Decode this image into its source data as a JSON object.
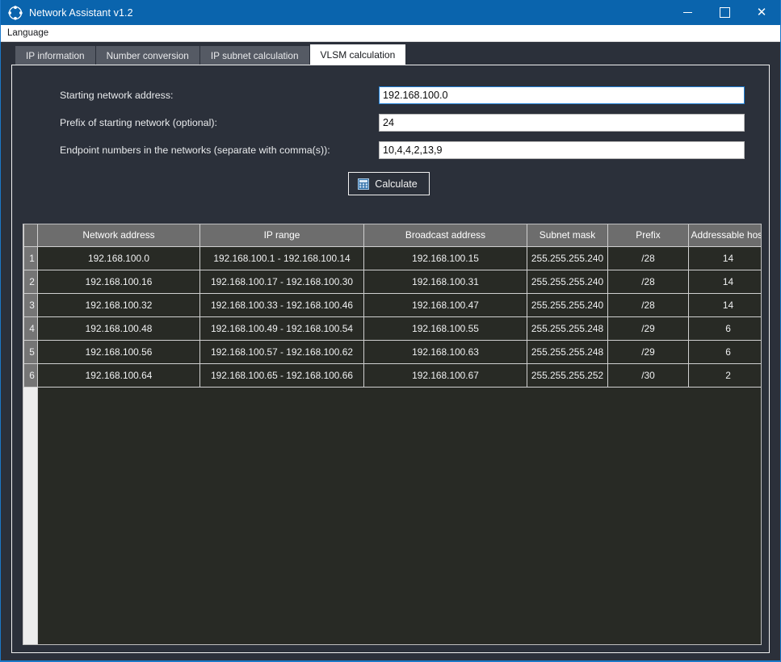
{
  "window": {
    "title": "Network Assistant v1.2",
    "icon": "network-hub-icon",
    "accent_color": "#0a64ad",
    "background_color": "#2b303a",
    "controls": {
      "minimize": "minimize-icon",
      "maximize": "maximize-icon",
      "close": "close-icon"
    }
  },
  "menubar": {
    "items": [
      {
        "label": "Language"
      }
    ]
  },
  "tabs": [
    {
      "label": "IP information",
      "active": false
    },
    {
      "label": "Number conversion",
      "active": false
    },
    {
      "label": "IP subnet calculation",
      "active": false
    },
    {
      "label": "VLSM calculation",
      "active": true
    }
  ],
  "form": {
    "fields": [
      {
        "label": "Starting network address:",
        "value": "192.168.100.0",
        "placeholder": "",
        "focused": true
      },
      {
        "label": "Prefix of starting network (optional):",
        "value": "24",
        "placeholder": "",
        "focused": false
      },
      {
        "label": "Endpoint numbers in the networks (separate with comma(s)):",
        "value": "10,4,4,2,13,9",
        "placeholder": "",
        "focused": false
      }
    ],
    "calculate_label": "Calculate"
  },
  "results_table": {
    "row_number_header": "",
    "columns": [
      "Network address",
      "IP range",
      "Broadcast address",
      "Subnet mask",
      "Prefix",
      "Addressable host"
    ],
    "rows": [
      {
        "n": "1",
        "network": "192.168.100.0",
        "range": "192.168.100.1 - 192.168.100.14",
        "broadcast": "192.168.100.15",
        "mask": "255.255.255.240",
        "prefix": "/28",
        "hosts": "14"
      },
      {
        "n": "2",
        "network": "192.168.100.16",
        "range": "192.168.100.17 - 192.168.100.30",
        "broadcast": "192.168.100.31",
        "mask": "255.255.255.240",
        "prefix": "/28",
        "hosts": "14"
      },
      {
        "n": "3",
        "network": "192.168.100.32",
        "range": "192.168.100.33 - 192.168.100.46",
        "broadcast": "192.168.100.47",
        "mask": "255.255.255.240",
        "prefix": "/28",
        "hosts": "14"
      },
      {
        "n": "4",
        "network": "192.168.100.48",
        "range": "192.168.100.49 - 192.168.100.54",
        "broadcast": "192.168.100.55",
        "mask": "255.255.255.248",
        "prefix": "/29",
        "hosts": "6"
      },
      {
        "n": "5",
        "network": "192.168.100.56",
        "range": "192.168.100.57 - 192.168.100.62",
        "broadcast": "192.168.100.63",
        "mask": "255.255.255.248",
        "prefix": "/29",
        "hosts": "6"
      },
      {
        "n": "6",
        "network": "192.168.100.64",
        "range": "192.168.100.65 - 192.168.100.66",
        "broadcast": "192.168.100.67",
        "mask": "255.255.255.252",
        "prefix": "/30",
        "hosts": "2"
      }
    ]
  }
}
